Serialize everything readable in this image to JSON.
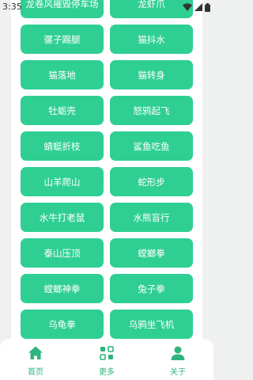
{
  "status_bar": {
    "time": "3:35"
  },
  "grid": {
    "rows": [
      [
        "龙卷风摧毁停车场",
        "龙虾爪"
      ],
      [
        "骡子踢腿",
        "猫抖水"
      ],
      [
        "猫落地",
        "猫转身"
      ],
      [
        "牡蛎壳",
        "怒鸦起飞"
      ],
      [
        "蜻蜓折枝",
        "鲨鱼吃鱼"
      ],
      [
        "山羊爬山",
        "蛇形步"
      ],
      [
        "水牛打老鼠",
        "水熊盲行"
      ],
      [
        "泰山压顶",
        "螳螂拳"
      ],
      [
        "螳螂神拳",
        "兔子拳"
      ],
      [
        "乌龟拳",
        "乌鸦坐飞机"
      ]
    ]
  },
  "bottom_nav": {
    "items": [
      {
        "label": "首页",
        "icon": "home-icon"
      },
      {
        "label": "更多",
        "icon": "grid-more-icon"
      },
      {
        "label": "关于",
        "icon": "user-icon"
      }
    ]
  },
  "colors": {
    "accent": "#2fcf93",
    "nav_text": "#2fb47f"
  }
}
